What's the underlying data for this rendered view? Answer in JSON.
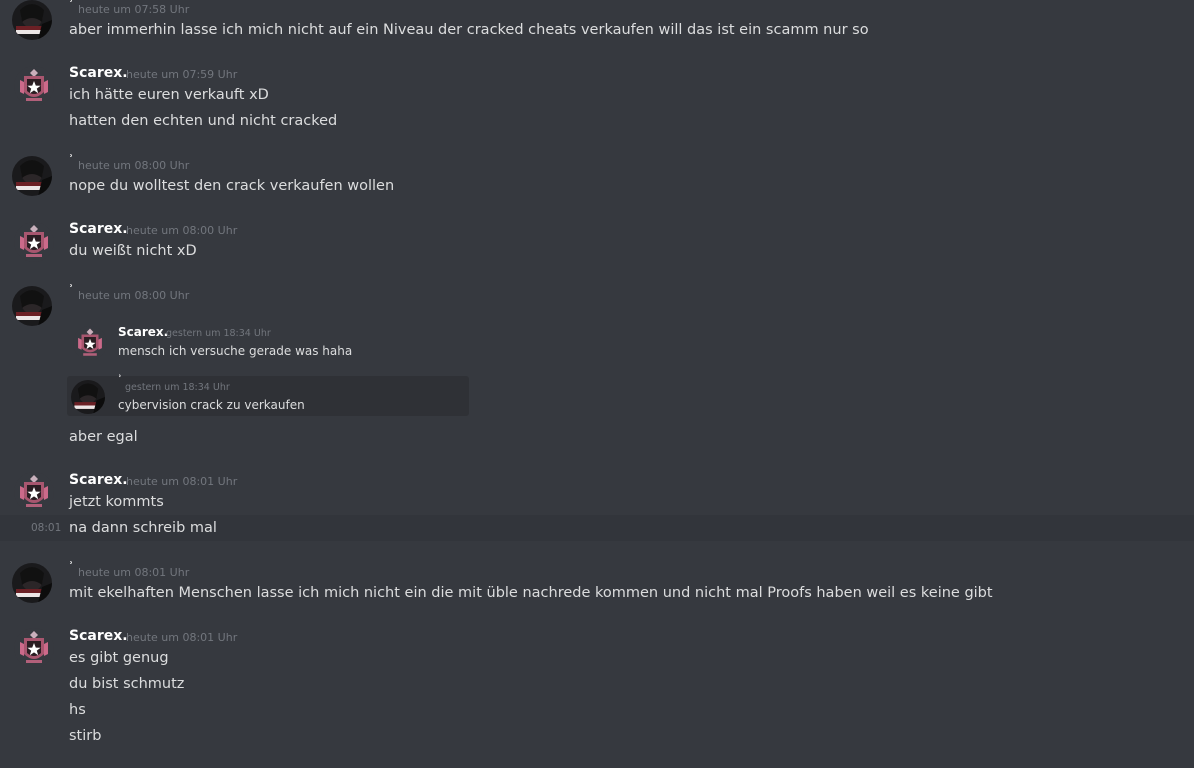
{
  "messages": [
    {
      "user": "ʾ",
      "time": "heute um 07:58 Uhr",
      "lines": [
        "aber immerhin lasse ich mich nicht auf ein Niveau der cracked cheats verkaufen will das ist ein scamm nur so"
      ]
    },
    {
      "user": "Scarex.",
      "time": "heute um 07:59 Uhr",
      "lines": [
        "ich hätte euren verkauft xD",
        "hatten den echten und nicht cracked"
      ]
    },
    {
      "user": "ʾ",
      "time": "heute um 08:00 Uhr",
      "lines": [
        "nope du wolltest den crack verkaufen wollen"
      ]
    },
    {
      "user": "Scarex.",
      "time": "heute um 08:00 Uhr",
      "lines": [
        "du weißt nicht xD"
      ]
    },
    {
      "user": "ʾ",
      "time": "heute um 08:00 Uhr",
      "lines": [
        "aber egal"
      ]
    },
    {
      "user": "Scarex.",
      "time": "heute um 08:01 Uhr",
      "lines": [
        "jetzt kommts",
        "na dann schreib mal"
      ]
    },
    {
      "user": "ʾ",
      "time": "heute um 08:01 Uhr",
      "lines": [
        "mit ekelhaften Menschen lasse ich mich nicht ein die mit üble nachrede kommen und nicht mal Proofs haben weil es keine gibt"
      ]
    },
    {
      "user": "Scarex.",
      "time": "heute um 08:01 Uhr",
      "lines": [
        "es gibt genug",
        "du bist schmutz",
        "hs",
        "stirb"
      ]
    }
  ],
  "quoted": [
    {
      "user": "Scarex.",
      "time": "gestern um 18:34 Uhr",
      "text": "mensch ich versuche gerade was haha"
    },
    {
      "user": "ʾ",
      "time": "gestern um 18:34 Uhr",
      "text": "cybervision crack zu verkaufen"
    }
  ],
  "hover_timestamp": "08:01",
  "colors": {
    "background": "#36393f",
    "text": "#dcddde",
    "username": "#ffffff",
    "timestamp": "#72767d",
    "embed": "#2f3136"
  },
  "icons": {
    "dark_user_avatar": "dark-hooded-avatar-icon",
    "scarex_avatar": "crest-star-avatar-icon"
  }
}
